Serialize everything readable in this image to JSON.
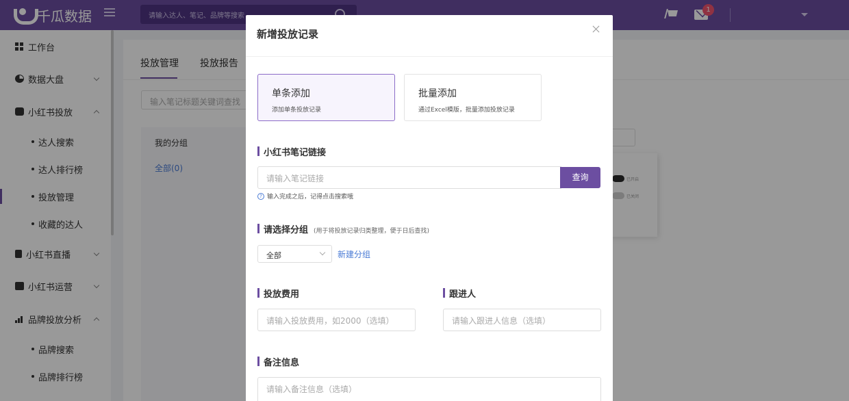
{
  "app": {
    "logo_text": "千瓜数据",
    "search_placeholder": "请输入达人、笔记、品牌等搜索",
    "message_count": "1"
  },
  "sidebar": {
    "items": [
      {
        "label": "工作台",
        "icon": "grid-icon"
      },
      {
        "label": "数据大盘",
        "icon": "pie-icon"
      },
      {
        "label": "小红书投放",
        "icon": "xhs-icon"
      },
      {
        "label": "小红书直播",
        "icon": "video-icon"
      },
      {
        "label": "小红书运营",
        "icon": "ops-icon"
      },
      {
        "label": "品牌投放分析",
        "icon": "chart-icon"
      }
    ],
    "sub_xhs_ads": [
      "达人搜索",
      "达人排行榜",
      "投放管理",
      "收藏的达人"
    ],
    "sub_brand": [
      "品牌搜索",
      "品牌排行榜"
    ]
  },
  "main": {
    "tabs": [
      "投放管理",
      "投放报告"
    ],
    "search_placeholder": "输入笔记标题关键词查找",
    "group_title": "我的分组",
    "group_all": "全部(0)",
    "toggle_on_label": "已开启",
    "toggle_off_label": "已关闭"
  },
  "modal": {
    "title": "新增投放记录",
    "modes": [
      {
        "title": "单条添加",
        "desc": "添加单条投放记录",
        "active": true
      },
      {
        "title": "批量添加",
        "desc": "通过Excel模版，批量添加投放记录",
        "active": false
      }
    ],
    "link_section": {
      "title": "小红书笔记链接",
      "placeholder": "请输入笔记链接",
      "button": "查询",
      "hint": "输入完成之后，记得点击搜索哦"
    },
    "group_section": {
      "title": "请选择分组",
      "hint": "(用于将投放记录归类整理，便于日后查找)",
      "selected": "全部",
      "new_group": "新建分组"
    },
    "cost_section": {
      "title": "投放费用",
      "placeholder": "请输入投放费用，如2000（选填）"
    },
    "follower_section": {
      "title": "跟进人",
      "placeholder": "请输入跟进人信息（选填）"
    },
    "remark_section": {
      "title": "备注信息",
      "placeholder": "请输入备注信息（选填）"
    }
  }
}
